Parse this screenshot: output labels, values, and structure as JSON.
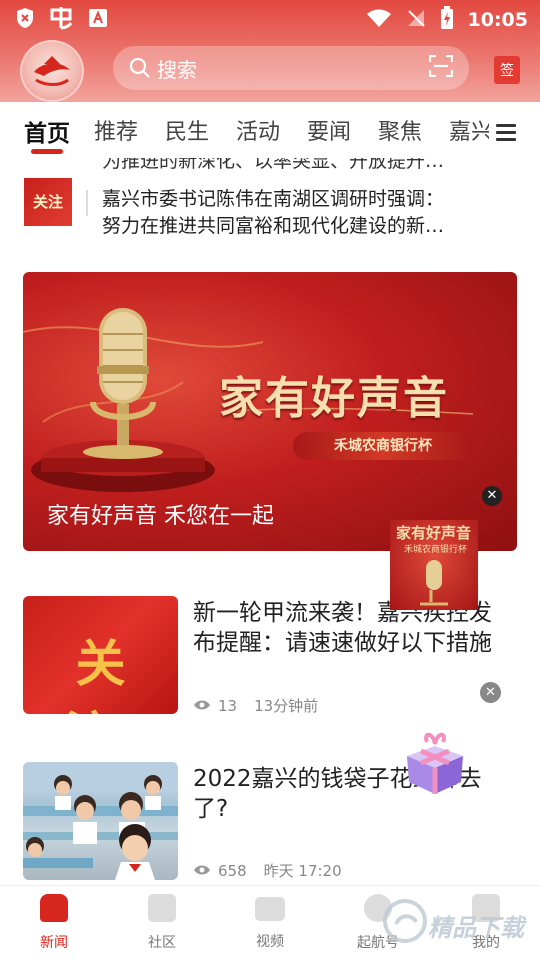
{
  "status_bar": {
    "time": "10:05"
  },
  "header": {
    "search_placeholder": "搜索",
    "sign_label": "签"
  },
  "tabs": [
    {
      "label": "首页",
      "active": true
    },
    {
      "label": "推荐"
    },
    {
      "label": "民生"
    },
    {
      "label": "活动"
    },
    {
      "label": "要闻"
    },
    {
      "label": "聚焦"
    },
    {
      "label": "嘉兴"
    }
  ],
  "feed": {
    "partial_prev_title": "为推进的新深化、以率突显、开放提升…",
    "item1": {
      "thumb_text": "关注",
      "title_line1": "嘉兴市委书记陈伟在南湖区调研时强调：",
      "title_line2": "努力在推进共同富裕和现代化建设的新…"
    },
    "banner": {
      "title": "家有好声音",
      "subtitle": "禾城农商银行杯",
      "caption": "家有好声音 禾您在一起"
    },
    "float_ad": {
      "title": "家有好声音",
      "subtitle": "禾城农商银行杯"
    },
    "item2": {
      "thumb_text": "关注",
      "title": "新一轮甲流来袭！嘉兴疾控发布提醒：请速速做好以下措施",
      "views": "13",
      "time": "13分钟前"
    },
    "item3": {
      "title": "2022嘉兴的钱袋子花到哪去了?",
      "views": "658",
      "time": "昨天 17:20"
    }
  },
  "bottom_nav": [
    {
      "label": "新闻",
      "active": true
    },
    {
      "label": "社区"
    },
    {
      "label": "视频"
    },
    {
      "label": "起航号"
    },
    {
      "label": "我的"
    }
  ],
  "watermark": {
    "text": "精品下载"
  },
  "colors": {
    "brand_red": "#d7261e",
    "header_red": "#e2483f"
  }
}
